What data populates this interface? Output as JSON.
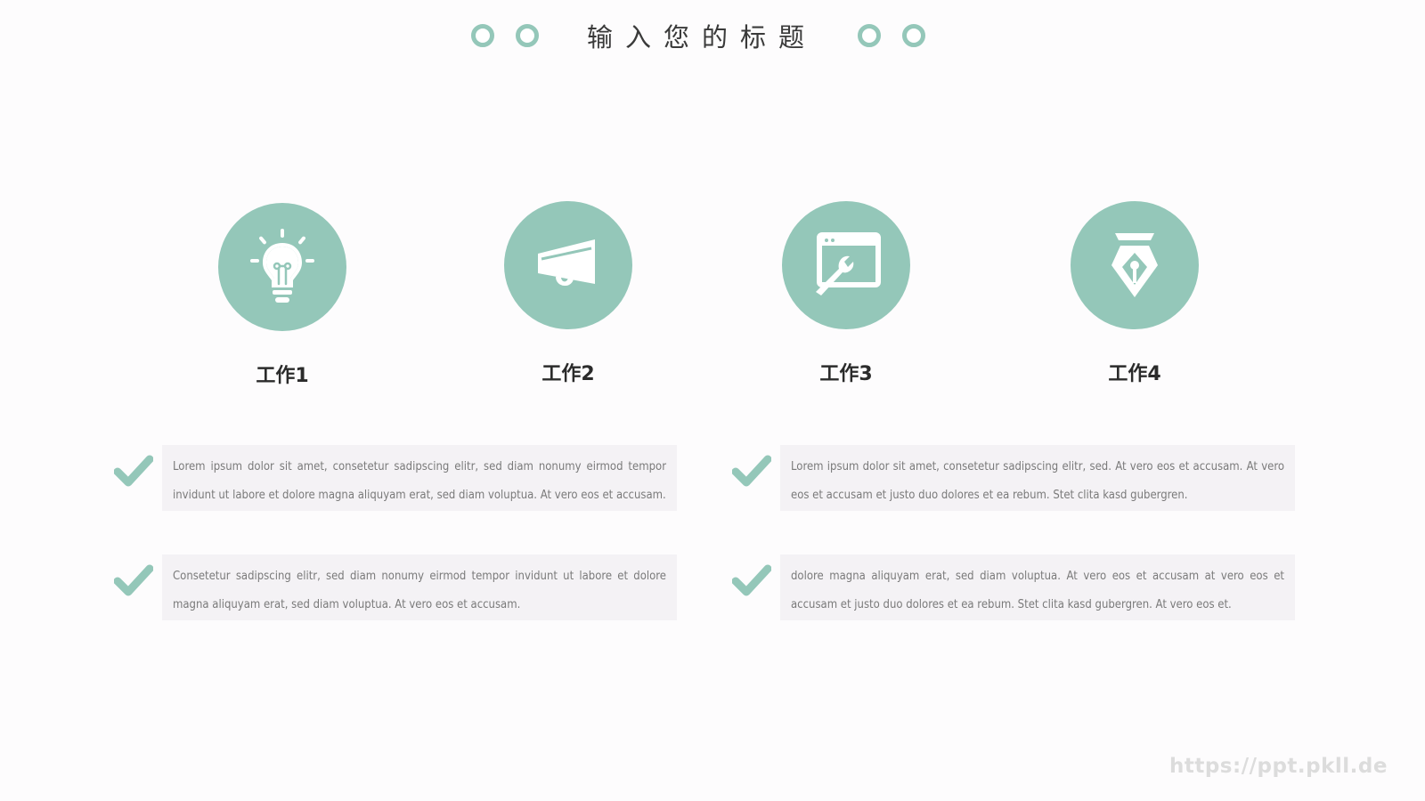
{
  "colors": {
    "accent": "#94c7b9",
    "box_bg": "#f4f2f5",
    "title_text": "#3a3a3a",
    "body_text": "#7a7a7a",
    "watermark": "#dcdcdc"
  },
  "header": {
    "title": "输入您的标题",
    "decorations": [
      "ring-icon",
      "ring-icon",
      "ring-icon",
      "ring-icon"
    ]
  },
  "features": [
    {
      "label": "工作1",
      "icon": "lightbulb-icon"
    },
    {
      "label": "工作2",
      "icon": "megaphone-icon"
    },
    {
      "label": "工作3",
      "icon": "browser-wrench-icon"
    },
    {
      "label": "工作4",
      "icon": "pen-nib-icon"
    }
  ],
  "points": [
    {
      "icon": "check-icon",
      "text": "Lorem ipsum dolor sit amet, consetetur sadipscing elitr, sed diam nonumy eirmod tempor invidunt ut labore et dolore magna aliquyam erat, sed diam voluptua. At vero eos et accusam."
    },
    {
      "icon": "check-icon",
      "text": "Lorem ipsum dolor sit amet, consetetur sadipscing elitr, sed. At vero eos et accusam. At vero eos et accusam et justo duo dolores et ea rebum. Stet clita kasd gubergren."
    },
    {
      "icon": "check-icon",
      "text": "Consetetur sadipscing elitr, sed diam nonumy eirmod tempor invidunt ut labore et dolore magna aliquyam erat, sed diam voluptua. At vero eos et accusam."
    },
    {
      "icon": "check-icon",
      "text": "dolore magna aliquyam erat, sed diam voluptua. At vero eos et accusam at vero eos et accusam et justo duo dolores et ea rebum. Stet clita kasd gubergren. At vero eos et."
    }
  ],
  "watermark": "https://ppt.pkll.de"
}
